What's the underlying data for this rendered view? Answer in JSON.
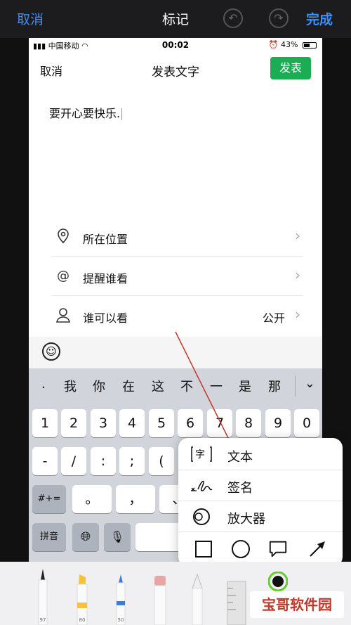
{
  "markup_bar": {
    "cancel": "取消",
    "title": "标记",
    "done": "完成"
  },
  "status_bar": {
    "carrier": "中国移动",
    "time": "00:02",
    "battery": "43%"
  },
  "nav": {
    "cancel": "取消",
    "title": "发表文字",
    "post": "发表"
  },
  "post_text": "要开心要快乐.",
  "options": [
    {
      "label": "所在位置",
      "value": "",
      "icon": "location-pin-icon"
    },
    {
      "label": "提醒谁看",
      "value": "",
      "icon": "at-icon"
    },
    {
      "label": "谁可以看",
      "value": "公开",
      "icon": "person-icon"
    }
  ],
  "keyboard": {
    "candidates": [
      ".",
      "我",
      "你",
      "在",
      "这",
      "不",
      "一",
      "是",
      "那"
    ],
    "digits": [
      "1",
      "2",
      "3",
      "4",
      "5",
      "6",
      "7",
      "8",
      "9",
      "0"
    ],
    "row2": [
      "-",
      "/",
      ":",
      ";",
      "("
    ],
    "row3_left": "#+=",
    "row3": [
      "。",
      "，",
      "、"
    ],
    "pinyin": "拼音"
  },
  "popover": {
    "items": [
      {
        "label": "文本",
        "icon": "text-box-icon",
        "glyph": "字"
      },
      {
        "label": "签名",
        "icon": "signature-icon"
      },
      {
        "label": "放大器",
        "icon": "magnifier-icon"
      }
    ],
    "shapes": [
      "square-shape",
      "circle-shape",
      "speech-bubble-shape",
      "arrow-shape"
    ]
  },
  "tools": [
    {
      "name": "pen-tool",
      "num": "97",
      "color": "#222222"
    },
    {
      "name": "highlighter-tool",
      "num": "80",
      "color": "#f5c23a"
    },
    {
      "name": "pencil-tool",
      "num": "50",
      "color": "#3b7dd8"
    },
    {
      "name": "eraser-tool",
      "num": "",
      "color": "#e8a5a5"
    },
    {
      "name": "lasso-tool",
      "num": "",
      "color": "#cccccc"
    },
    {
      "name": "ruler-tool",
      "num": "",
      "color": "#bbbbbb"
    }
  ],
  "annotation_color": "#c0392b",
  "watermark": "宝哥软件园"
}
